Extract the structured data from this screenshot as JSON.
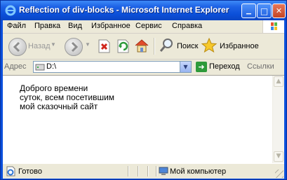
{
  "window": {
    "title": "Reflection of div-blocks - Microsoft Internet Explorer",
    "controls": {
      "minimize_glyph": "▁",
      "maximize_glyph": "□",
      "close_glyph": "✕"
    }
  },
  "menubar": {
    "items": [
      "Файл",
      "Правка",
      "Вид",
      "Избранное",
      "Сервис",
      "Справка"
    ]
  },
  "toolbar": {
    "back_label": "Назад",
    "search_label": "Поиск",
    "favorites_label": "Избранное"
  },
  "addressbar": {
    "label": "Адрес",
    "value": "D:\\",
    "go_label": "Переход",
    "links_label": "Ссылки"
  },
  "content": {
    "lines": [
      "Доброго времени",
      "суток, всем посетившим",
      "мой сказочный сайт"
    ]
  },
  "statusbar": {
    "status_text": "Готово",
    "zone_text": "Мой компьютер"
  },
  "colors": {
    "titlebar": "#0b4fd8",
    "chrome": "#ece9d8",
    "close_button": "#c44424",
    "go_button": "#2e9a3a"
  }
}
